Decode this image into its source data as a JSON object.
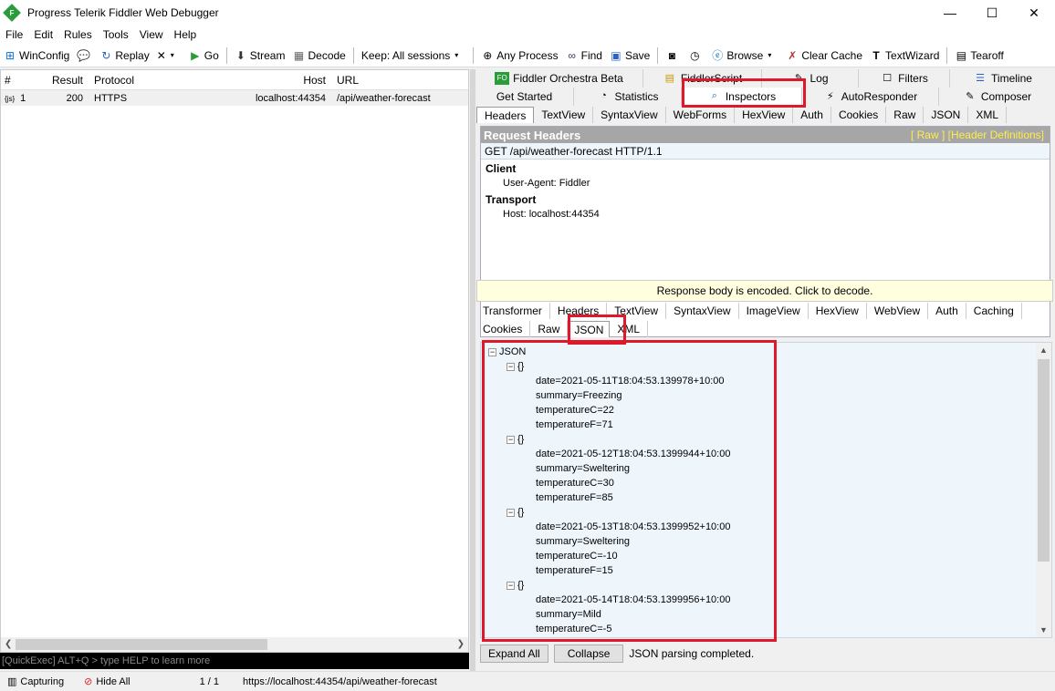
{
  "window": {
    "title": "Progress Telerik Fiddler Web Debugger",
    "min": "—",
    "max": "☐",
    "close": "✕"
  },
  "menu": [
    "File",
    "Edit",
    "Rules",
    "Tools",
    "View",
    "Help"
  ],
  "toolbar": {
    "winconfig": "WinConfig",
    "replay": "Replay",
    "remove": "✕",
    "go": "Go",
    "stream": "Stream",
    "decode": "Decode",
    "keep": "Keep: All sessions",
    "any_process": "Any Process",
    "find": "Find",
    "save": "Save",
    "browse": "Browse",
    "clear_cache": "Clear Cache",
    "textwizard": "TextWizard",
    "tearoff": "Tearoff"
  },
  "sessions": {
    "columns": [
      "#",
      "Result",
      "Protocol",
      "Host",
      "URL"
    ],
    "rows": [
      {
        "num": "1",
        "result": "200",
        "protocol": "HTTPS",
        "host": "localhost:44354",
        "url": "/api/weather-forecast"
      }
    ]
  },
  "quickexec": "[QuickExec] ALT+Q > type HELP to learn more",
  "status": {
    "capturing": "Capturing",
    "hide_all": "Hide All",
    "count": "1 / 1",
    "url": "https://localhost:44354/api/weather-forecast"
  },
  "top_tabs_row1": [
    "Fiddler Orchestra Beta",
    "FiddlerScript",
    "Log",
    "Filters",
    "Timeline"
  ],
  "top_tabs_row2": [
    "Get Started",
    "Statistics",
    "Inspectors",
    "AutoResponder",
    "Composer"
  ],
  "request_tabs": [
    "Headers",
    "TextView",
    "SyntaxView",
    "WebForms",
    "HexView",
    "Auth",
    "Cookies",
    "Raw",
    "JSON",
    "XML"
  ],
  "request": {
    "title": "Request Headers",
    "links": "[ Raw ]   [Header Definitions]",
    "line": "GET /api/weather-forecast HTTP/1.1",
    "client_label": "Client",
    "client_ua": "User-Agent: Fiddler",
    "transport_label": "Transport",
    "transport_host": "Host: localhost:44354"
  },
  "encoded_msg": "Response body is encoded. Click to decode.",
  "response_tabs_row1": [
    "Transformer",
    "Headers",
    "TextView",
    "SyntaxView",
    "ImageView",
    "HexView",
    "WebView",
    "Auth",
    "Caching"
  ],
  "response_tabs_row2": [
    "Cookies",
    "Raw",
    "JSON",
    "XML"
  ],
  "json": {
    "root": "JSON",
    "obj": "{}",
    "items": [
      {
        "date": "date=2021-05-11T18:04:53.139978+10:00",
        "summary": "summary=Freezing",
        "tc": "temperatureC=22",
        "tf": "temperatureF=71"
      },
      {
        "date": "date=2021-05-12T18:04:53.1399944+10:00",
        "summary": "summary=Sweltering",
        "tc": "temperatureC=30",
        "tf": "temperatureF=85"
      },
      {
        "date": "date=2021-05-13T18:04:53.1399952+10:00",
        "summary": "summary=Sweltering",
        "tc": "temperatureC=-10",
        "tf": "temperatureF=15"
      },
      {
        "date": "date=2021-05-14T18:04:53.1399956+10:00",
        "summary": "summary=Mild",
        "tc": "temperatureC=-5"
      }
    ]
  },
  "bottom": {
    "expand": "Expand All",
    "collapse": "Collapse",
    "status": "JSON parsing completed."
  },
  "colors": {
    "highlight": "#e0182b",
    "accent_green": "#2a9d3a"
  }
}
